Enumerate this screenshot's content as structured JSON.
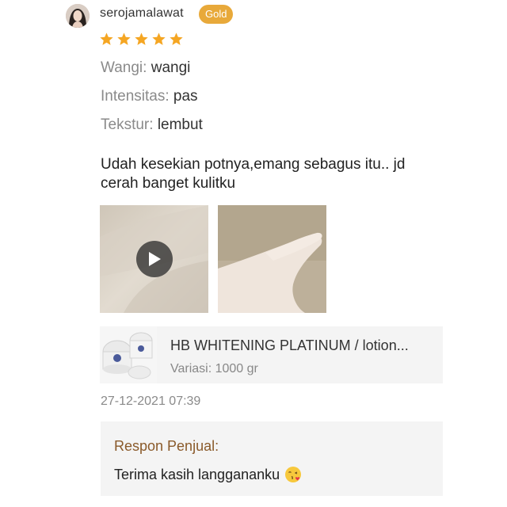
{
  "review": {
    "username": "serojamalawat",
    "badge": "Gold",
    "rating": 5,
    "attributes": [
      {
        "key": "Wangi:",
        "value": "wangi"
      },
      {
        "key": "Intensitas:",
        "value": "pas"
      },
      {
        "key": "Tekstur:",
        "value": "lembut"
      }
    ],
    "comment": "Udah kesekian potnya,emang sebagus itu.. jd cerah banget kulitku",
    "media": [
      {
        "type": "video",
        "icon": "play-icon"
      },
      {
        "type": "photo"
      }
    ],
    "product": {
      "name": "HB WHITENING PLATINUM / lotion...",
      "variant": "Variasi: 1000 gr"
    },
    "timestamp": "27-12-2021 07:39",
    "seller_response": {
      "title": "Respon Penjual:",
      "text": "Terima kasih langgananku",
      "emoji_icon": "face-blowing-kiss-icon"
    }
  },
  "colors": {
    "badge": "#e8a93a",
    "star": "#f5a623",
    "seller_title": "#8a5a2a",
    "panel_bg": "#f4f4f4"
  }
}
